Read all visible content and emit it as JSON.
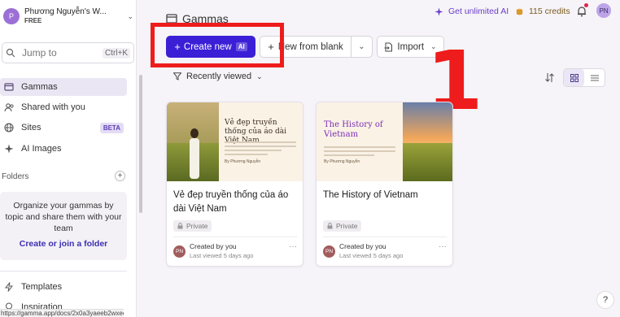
{
  "workspace": {
    "initial": "P",
    "name": "Phương Nguyễn's W...",
    "plan": "FREE"
  },
  "search": {
    "placeholder": "Jump to",
    "shortcut": "Ctrl+K"
  },
  "sidebar": {
    "items": [
      {
        "label": "Gammas",
        "icon": "gamma-icon",
        "active": true
      },
      {
        "label": "Shared with you",
        "icon": "shared-users-icon"
      },
      {
        "label": "Sites",
        "icon": "globe-icon",
        "badge": "BETA"
      },
      {
        "label": "AI Images",
        "icon": "sparkle-icon"
      }
    ],
    "folders_label": "Folders",
    "folders_empty_text": "Organize your gammas by topic and share them with your team",
    "folders_link": "Create or join a folder",
    "bottom_items": [
      {
        "label": "Templates",
        "icon": "bolt-icon"
      },
      {
        "label": "Inspiration",
        "icon": "lightbulb-icon"
      }
    ]
  },
  "status_url": "https://gamma.app/docs/2x0a3yaeeb2wxec",
  "header": {
    "title": "Gammas",
    "unlimited_ai": "Get unlimited AI",
    "credits": "115 credits",
    "user_initials": "PN"
  },
  "toolbar": {
    "create_label": "Create new",
    "ai_badge": "AI",
    "blank_label": "New from blank",
    "import_label": "Import"
  },
  "filter": {
    "label": "Recently viewed"
  },
  "annotation": {
    "number": "1",
    "color": "#ee1c1c"
  },
  "cards": [
    {
      "title": "Vẻ đẹp truyền thống của áo dài Việt Nam",
      "thumb_heading": "Vẻ đẹp truyền thống của áo dài Việt Nam",
      "thumb_author": "By Phương Nguyễn",
      "privacy": "Private",
      "creator_initials": "PN",
      "created_by": "Created by you",
      "last_viewed": "Last viewed 5 days ago"
    },
    {
      "title": "The History of Vietnam",
      "thumb_heading": "The History of Vietnam",
      "thumb_author": "By Phương Nguyễn",
      "privacy": "Private",
      "creator_initials": "PN",
      "created_by": "Created by you",
      "last_viewed": "Last viewed 5 days ago"
    }
  ],
  "help": {
    "label": "?"
  },
  "colors": {
    "primary": "#3b1fd6",
    "accent_purple": "#6a3cc9",
    "active_nav": "#ebe6f3"
  }
}
